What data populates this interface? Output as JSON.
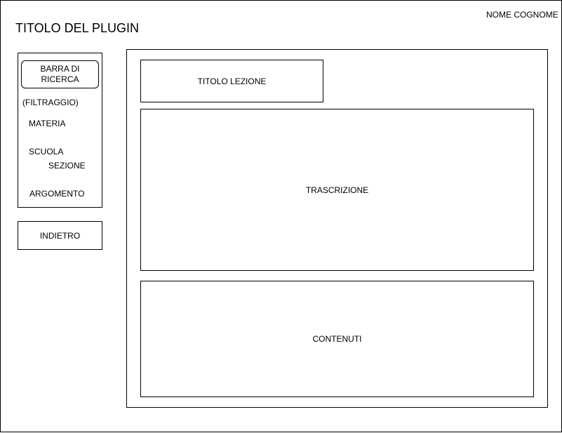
{
  "header": {
    "plugin_title": "TITOLO DEL PLUGIN",
    "user_name": "NOME COGNOME"
  },
  "sidebar": {
    "search_bar": "BARRA DI RICERCA",
    "filter_heading": "(FILTRAGGIO)",
    "filters": {
      "subject": "MATERIA",
      "school": "SCUOLA",
      "section": "SEZIONE",
      "topic": "ARGOMENTO"
    },
    "back_button": "INDIETRO"
  },
  "main": {
    "lesson_title": "TITOLO LEZIONE",
    "transcription": "TRASCRIZIONE",
    "contents": "CONTENUTI"
  }
}
